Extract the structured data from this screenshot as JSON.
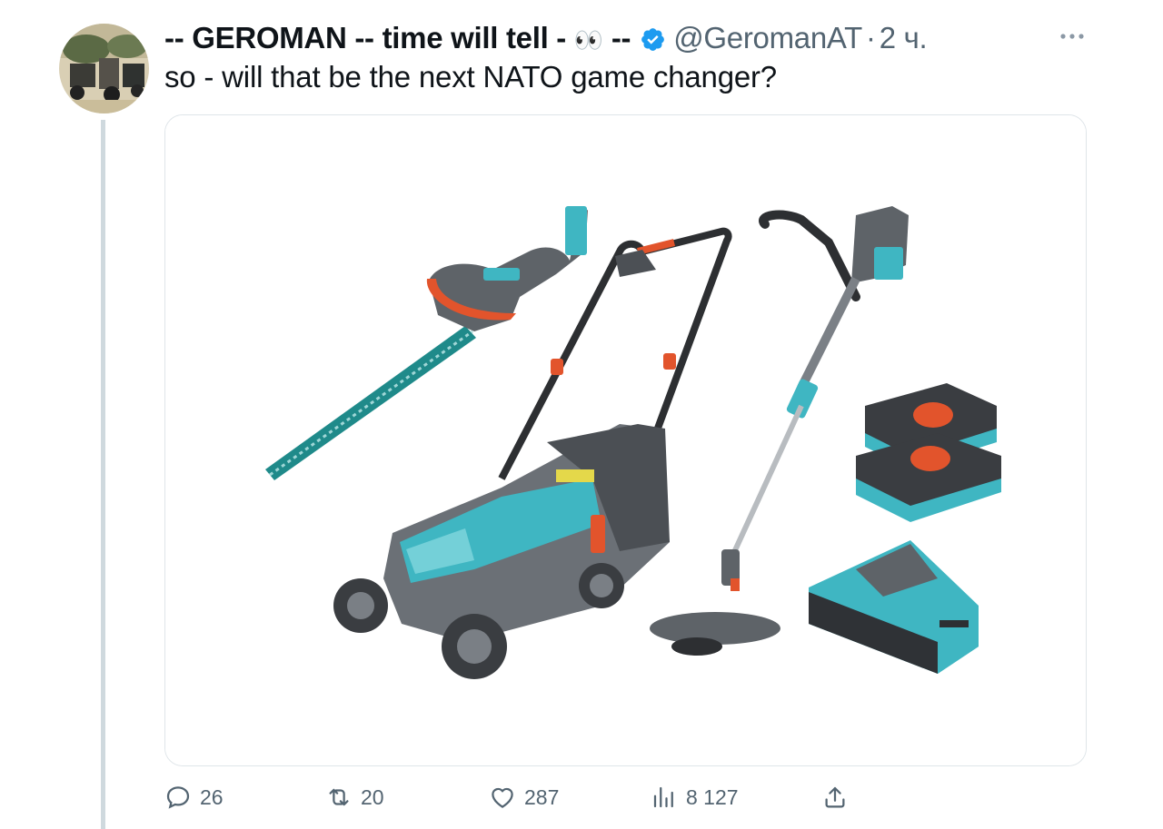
{
  "author": {
    "display_name": "-- GEROMAN -- time will tell -",
    "emoji": "👀",
    "name_suffix": "--",
    "handle": "@GeromanAT",
    "separator": "·",
    "timestamp": "2 ч.",
    "verified": true
  },
  "tweet": {
    "text": "so - will that be the next NATO game changer?"
  },
  "actions": {
    "replies": "26",
    "retweets": "20",
    "likes": "287",
    "views": "8 127"
  },
  "colors": {
    "text_primary": "#0f1419",
    "text_secondary": "#536471",
    "verified_blue": "#1d9bf0",
    "thread_line": "#cfd9de",
    "tool_teal": "#3fb6c2",
    "tool_grey": "#5e6368",
    "tool_orange": "#e2542c"
  },
  "icons": [
    "avatar",
    "verified-badge-icon",
    "more-icon",
    "reply-icon",
    "retweet-icon",
    "like-icon",
    "views-icon",
    "share-icon"
  ]
}
